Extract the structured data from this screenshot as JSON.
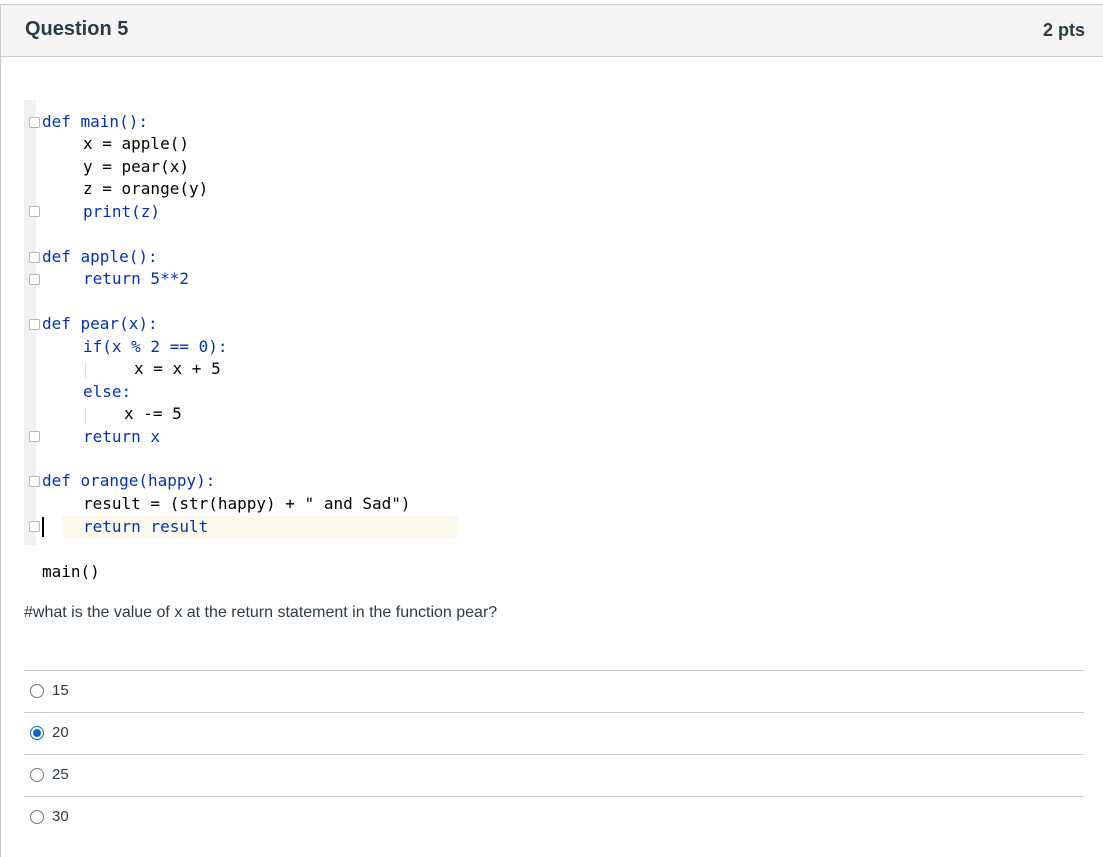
{
  "question": {
    "title": "Question 5",
    "points": "2 pts"
  },
  "code": {
    "lines": [
      "def main():",
      "x = apple()",
      "y = pear(x)",
      "z = orange(y)",
      "print(z)",
      "def apple():",
      "return 5**2",
      "def pear(x):",
      "if(x % 2 == 0):",
      "x = x + 5",
      "else:",
      "x -= 5",
      "return x",
      "def orange(happy):",
      "result = (str(happy) + \" and Sad\")",
      "return result",
      "main()"
    ]
  },
  "prompt": "#what is the value of x at the return statement in the function pear?",
  "answers": [
    {
      "label": "15",
      "selected": false
    },
    {
      "label": "20",
      "selected": true
    },
    {
      "label": "25",
      "selected": false
    },
    {
      "label": "30",
      "selected": false
    }
  ],
  "colors": {
    "keyword": "#0033b3",
    "number": "#1750eb",
    "string": "#067d17",
    "selected_radio": "#0b64c8"
  }
}
